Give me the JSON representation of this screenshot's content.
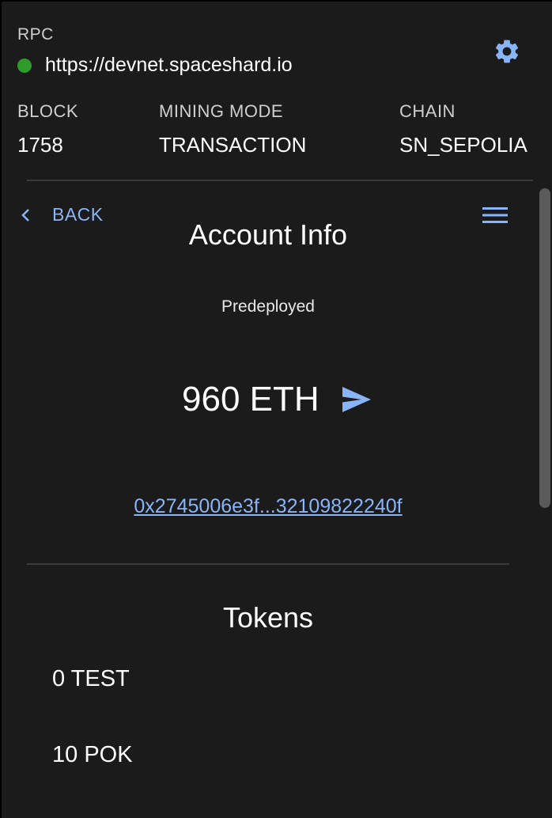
{
  "header": {
    "rpc_label": "RPC",
    "rpc_url": "https://devnet.spaceshard.io",
    "status_color": "#2e9b2a",
    "settings_icon": "gear-icon",
    "stats": [
      {
        "label": "BLOCK",
        "value": "1758"
      },
      {
        "label": "MINING MODE",
        "value": "TRANSACTION"
      },
      {
        "label": "CHAIN",
        "value": "SN_SEPOLIA"
      }
    ]
  },
  "account": {
    "back_label": "BACK",
    "title": "Account Info",
    "type": "Predeployed",
    "balance": "960 ETH",
    "address": "0x2745006e3f...32109822240f"
  },
  "tokens": {
    "title": "Tokens",
    "items": [
      {
        "label": "0 TEST"
      },
      {
        "label": "10 POK"
      }
    ]
  },
  "colors": {
    "background": "#1b1b1b",
    "accent": "#8ab4f8",
    "divider": "#3a3a3a"
  }
}
